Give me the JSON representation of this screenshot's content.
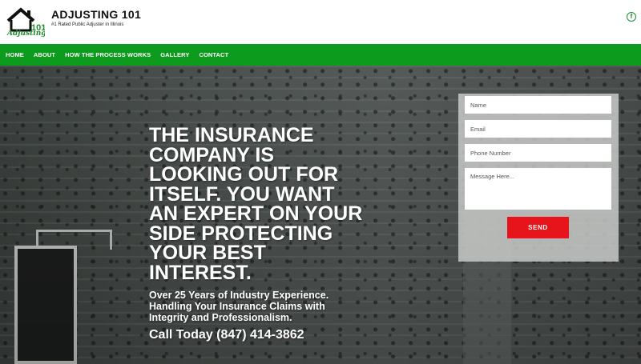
{
  "header": {
    "logo_text": "Adjusting 101",
    "title": "ADJUSTING 101",
    "tagline": "#1 Rated Public Adjuster in Illinois",
    "social_icon": "facebook-icon",
    "social_glyph": "f"
  },
  "nav": {
    "items": [
      {
        "label": "HOME"
      },
      {
        "label": "ABOUT"
      },
      {
        "label": "HOW THE PROCESS WORKS"
      },
      {
        "label": "GALLERY"
      },
      {
        "label": "CONTACT"
      }
    ]
  },
  "hero": {
    "headline": "THE INSURANCE COMPANY IS LOOKING OUT FOR ITSELF. YOU WANT AN EXPERT ON YOUR SIDE PROTECTING YOUR BEST INTEREST.",
    "subline": "Over 25 Years of Industry Experience. Handling Your Insurance Claims with Integrity and Professionalism.",
    "phone": "Call Today (847) 414-3862"
  },
  "form": {
    "name_placeholder": "Name",
    "email_placeholder": "Email",
    "phone_placeholder": "Phone Number",
    "message_placeholder": "Message Here...",
    "send_label": "SEND"
  },
  "colors": {
    "nav_green": "#0c9b1c",
    "send_red": "#e8141b"
  }
}
